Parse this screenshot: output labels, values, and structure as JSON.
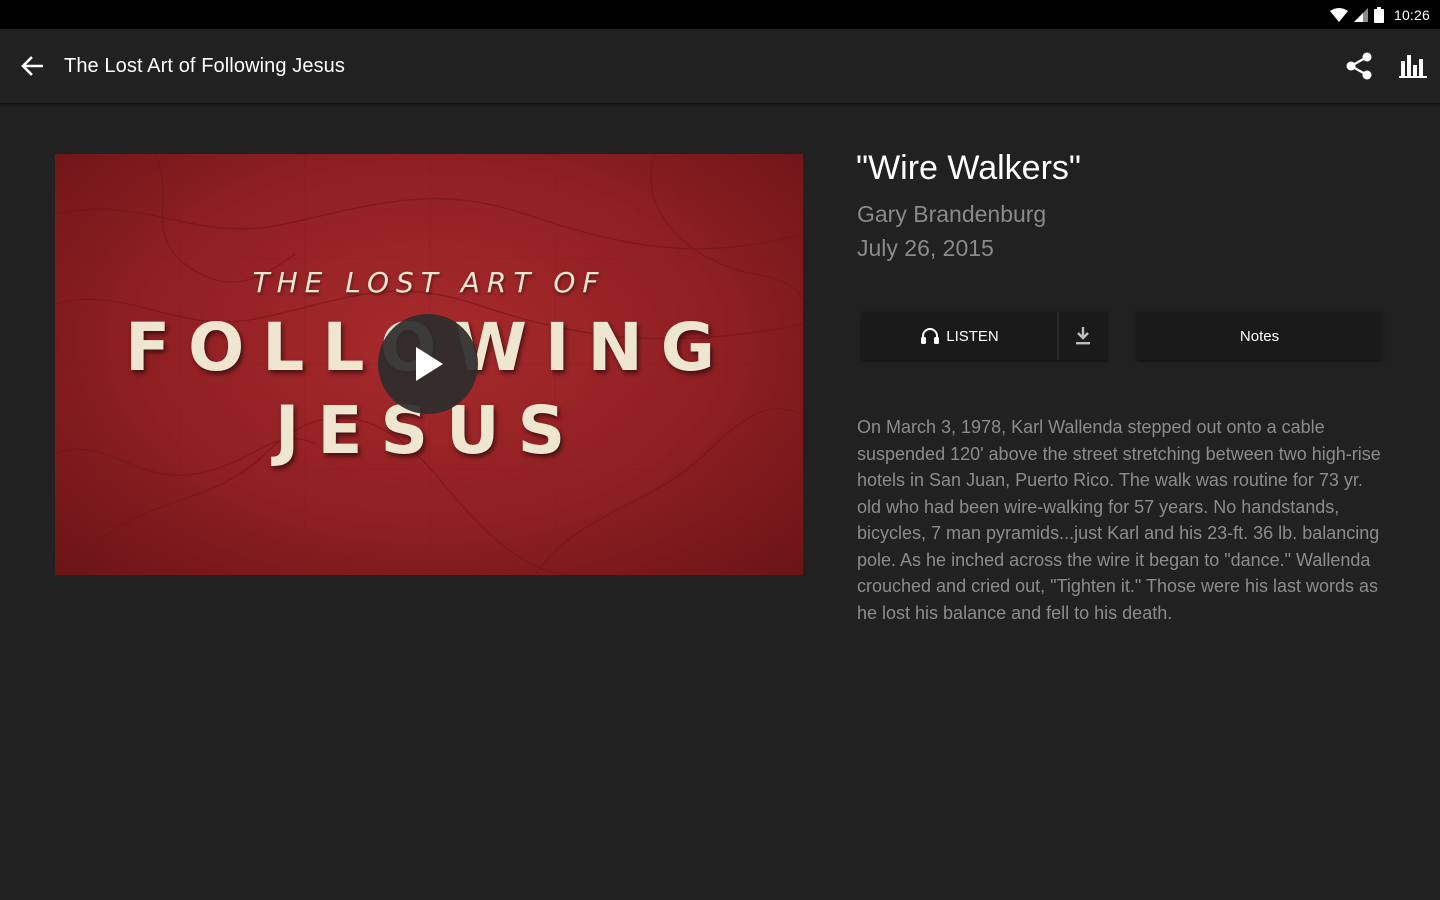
{
  "status_bar": {
    "time": "10:26"
  },
  "app_bar": {
    "title": "The Lost Art of Following Jesus",
    "back_icon": "arrow-back-icon",
    "actions": [
      "share-icon",
      "bar-chart-icon"
    ]
  },
  "video": {
    "art_overline": "THE LOST ART OF",
    "art_line1": "FOLLOWING",
    "art_line2": "JESUS",
    "play_icon": "play-icon"
  },
  "sermon": {
    "title": "\"Wire Walkers\"",
    "speaker": "Gary Brandenburg",
    "date": "July 26, 2015",
    "description": "On March 3, 1978, Karl Wallenda stepped out onto a cable suspended 120' above the street stretching between two high-rise hotels in San Juan, Puerto Rico. The walk was routine for 73 yr. old who had been wire-walking for 57 years. No handstands, bicycles, 7 man pyramids...just Karl and his 23-ft. 36 lb. balancing pole. As he inched across the wire it began to \"dance.\" Wallenda crouched and cried out, \"Tighten it.\" Those were his last words as he lost his balance and fell to his death."
  },
  "buttons": {
    "listen_label": "LISTEN",
    "notes_label": "Notes"
  },
  "colors": {
    "background": "#212121",
    "status_bar": "#000000",
    "art_red": "#8e1f22",
    "muted_text": "#8a8a8a"
  }
}
